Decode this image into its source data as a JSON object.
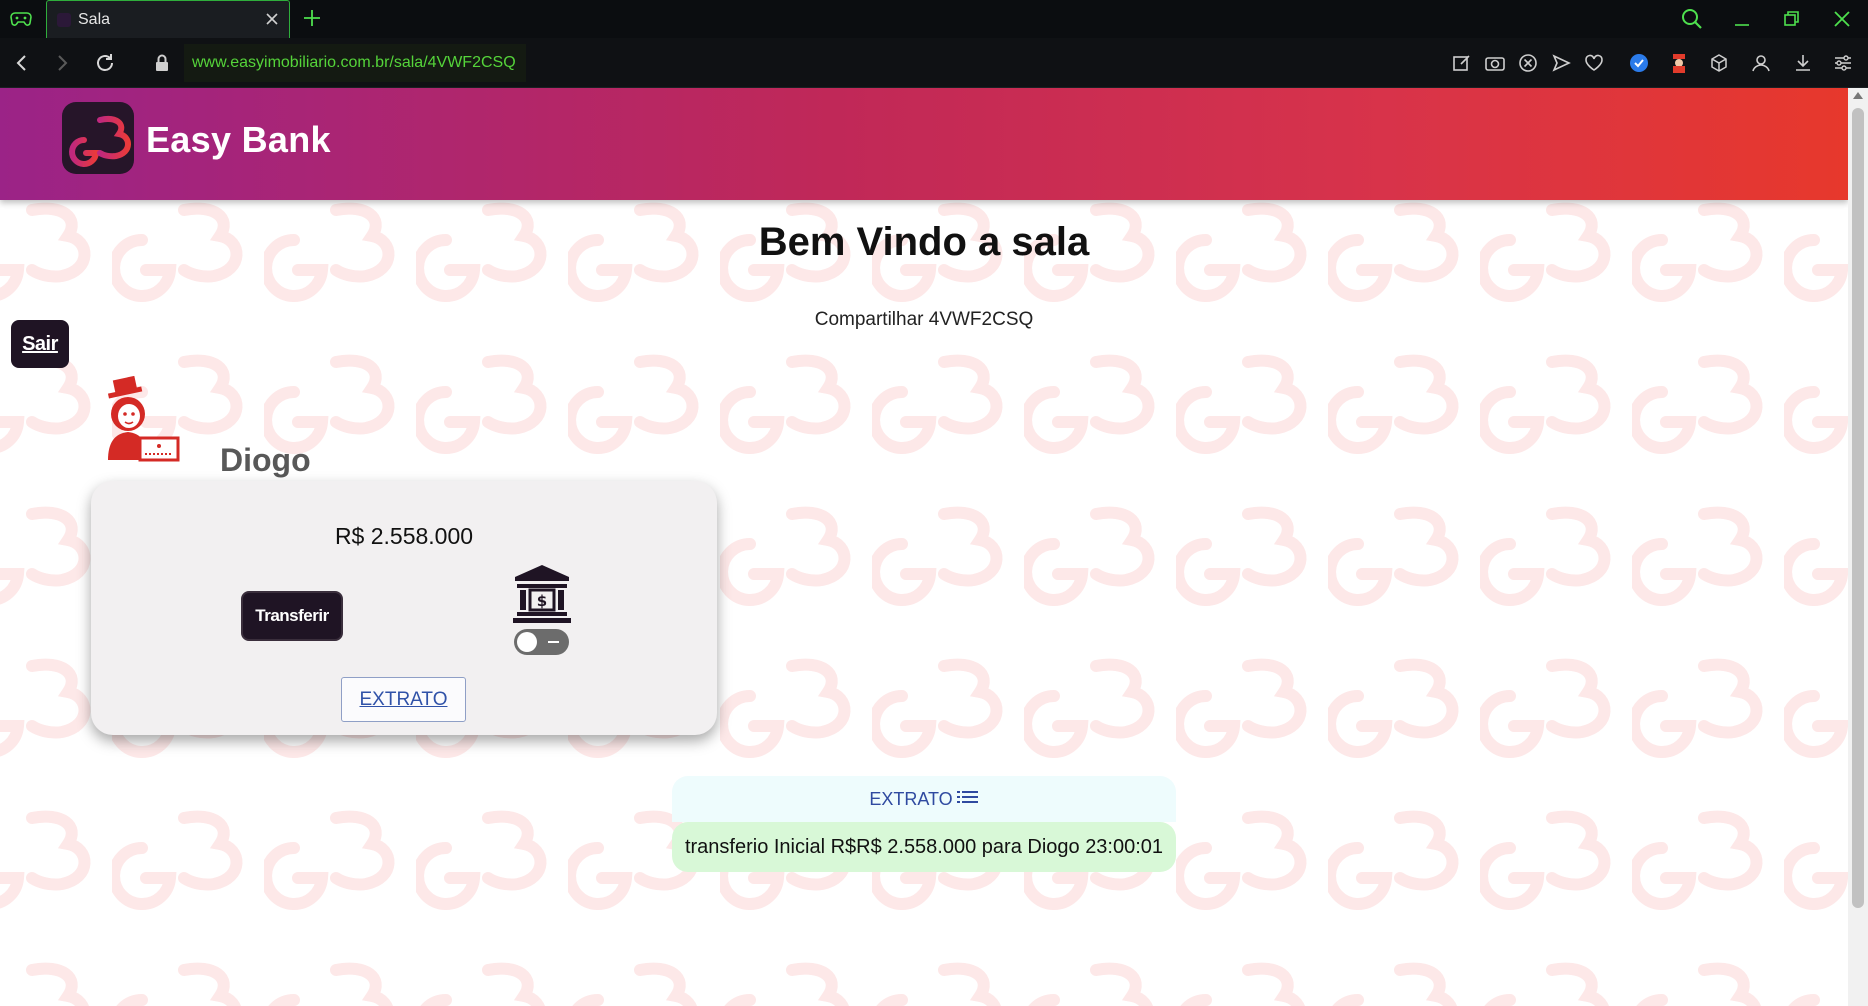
{
  "browser": {
    "tab_title": "Sala",
    "url": "www.easyimobiliario.com.br/sala/4VWF2CSQ"
  },
  "header": {
    "brand": "Easy Bank"
  },
  "main": {
    "welcome": "Bem Vindo a sala",
    "share": "Compartilhar 4VWF2CSQ",
    "sair_label": "Sair"
  },
  "player": {
    "name": "Diogo",
    "balance": "R$ 2.558.000",
    "transfer_label": "Transferir",
    "extrato_label": "EXTRATO",
    "bank_toggle_on": false
  },
  "statement": {
    "title": "EXTRATO",
    "entries": [
      {
        "text": "transferio Inicial R$R$ 2.558.000 para Diogo 23:00:01"
      }
    ]
  },
  "colors": {
    "header_gradient_start": "#9b2387",
    "header_gradient_end": "#e7382c",
    "dark_button": "#1f1424",
    "address_green": "#55d43a",
    "statement_entry_bg": "#d8f8d7",
    "watermark": "#fde8e8"
  },
  "icons": {
    "tab_menu": "gamepad-icon",
    "bank": "bank-icon",
    "avatar": "player-avatar-icon",
    "statement": "list-icon"
  }
}
